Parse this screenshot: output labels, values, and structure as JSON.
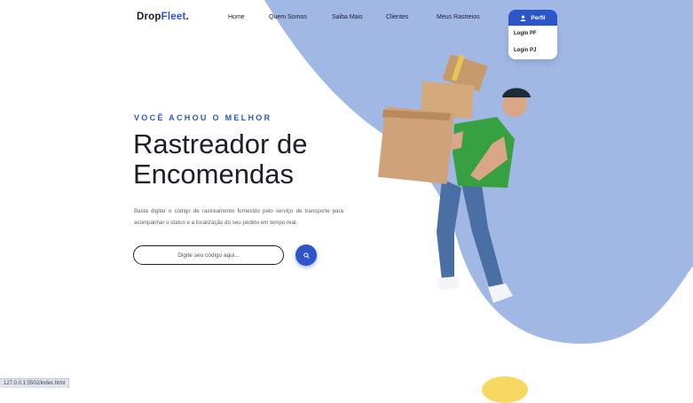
{
  "brand": {
    "name": "Drop",
    "accent": "Fleet",
    "dot": ".",
    "accent_color": "#2d56c9"
  },
  "nav": {
    "items": [
      "Home",
      "Quem Somos",
      "Saiba Mais",
      "Clientes",
      "Meus Rastreios"
    ]
  },
  "profile": {
    "label": "Perfil",
    "icon": "user-icon",
    "menu": [
      "Login PF",
      "Login PJ"
    ]
  },
  "hero": {
    "kicker": "VOCÊ ACHOU O MELHOR",
    "title_line1": "Rastreador de",
    "title_line2": "Encomendas",
    "description": "Basta digitar o código de rastreamento fornecido pelo serviço de transporte para acompanhar o status e a localização do seu pedido em tempo real."
  },
  "search": {
    "placeholder": "Digite seu código aqui...",
    "icon": "search-icon"
  },
  "status_bar": {
    "url": "127.0.0.1:5502/index.html"
  },
  "colors": {
    "primary": "#2d56c9",
    "blob": "#a2b8e4",
    "text": "#1b1f2a"
  }
}
